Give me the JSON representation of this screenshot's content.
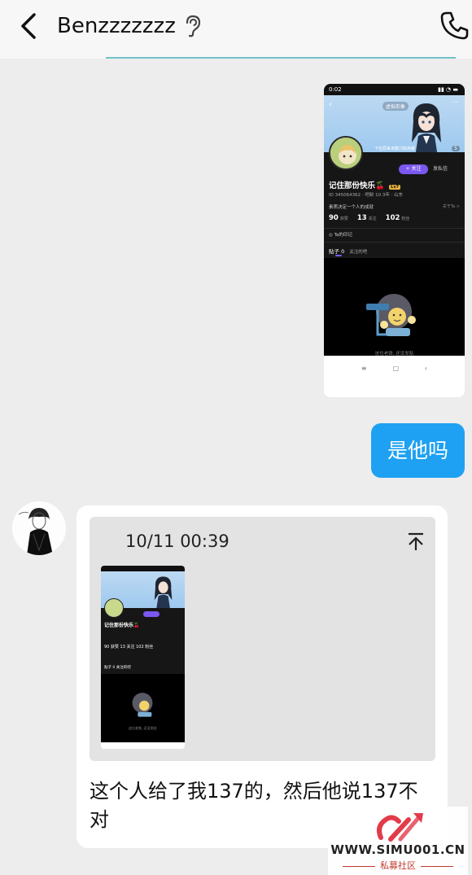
{
  "header": {
    "title": "Benzzzzzzz",
    "back_icon": "chevron-left-icon",
    "ear_icon": "ear-icon",
    "call_icon": "phone-icon"
  },
  "outgoing_screenshot": {
    "status_time": "0:02",
    "tag": "虚拟形象",
    "hero_note": "下位原来该删刀取用戴",
    "count": "5",
    "follow": "+ 关注",
    "message": "发私信",
    "name": "记住那份快乐🍒",
    "level": "Lv7",
    "id_line": "ID 345064362 · 吧龄 10.3年 · 山东",
    "desc": "素质决定一个人的成就",
    "desc_more": "关于Ta >",
    "stats": [
      {
        "value": "90",
        "label": "获赞"
      },
      {
        "value": "13",
        "label": "关注"
      },
      {
        "value": "102",
        "label": "粉丝"
      }
    ],
    "mark": "Ta的印记",
    "tab_active": "贴子 0",
    "tab_other": "关注的吧",
    "empty_text": "这位老铁, 还没发贴"
  },
  "outgoing_text": "是他吗",
  "incoming": {
    "quote_time": "10/11 00:39",
    "text": "这个人给了我137的，然后他说137不对",
    "mini": {
      "name": "记住那份快乐🍒",
      "stats": "90 获赞   13 关注   102 粉丝",
      "tab": "贴子 0   关注的吧",
      "empty": "这位老铁, 还没发贴"
    }
  },
  "watermark": {
    "url": "WWW.SIMU001.CN",
    "sub": "私募社区"
  },
  "colors": {
    "accent_blue": "#1ea1f2",
    "teal_line": "#71c1c9",
    "purple": "#7a58f0"
  }
}
